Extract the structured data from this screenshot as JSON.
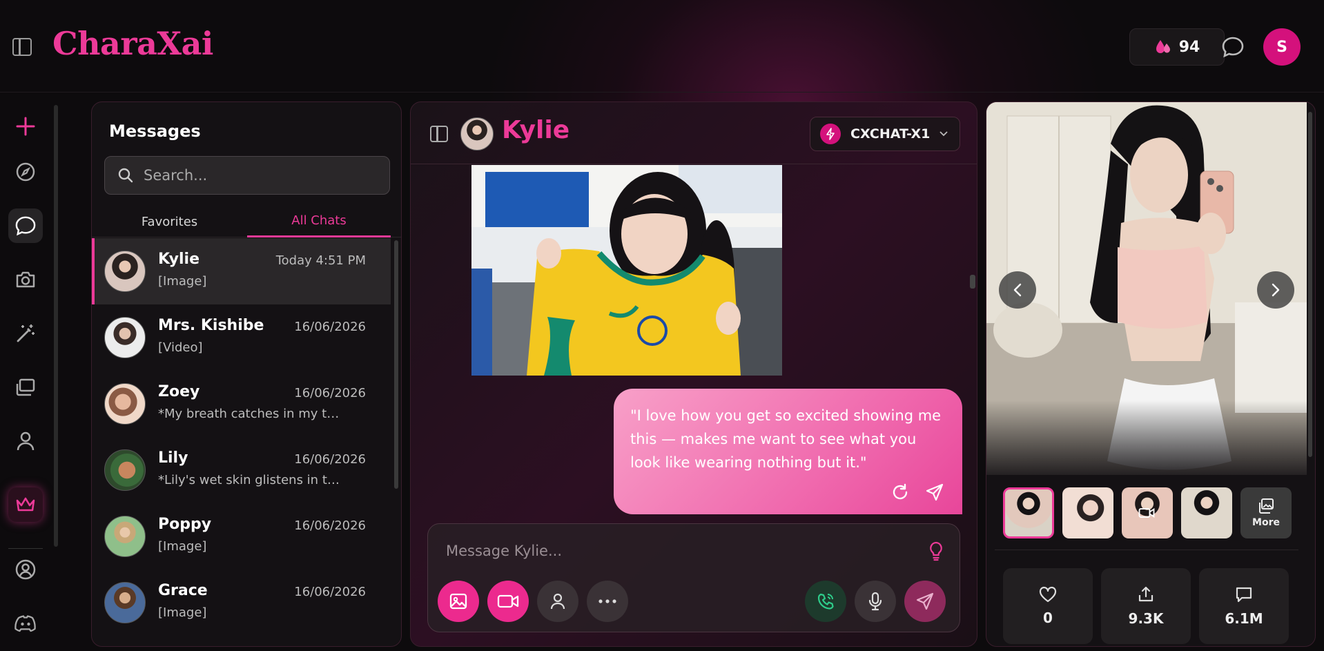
{
  "app": {
    "logo": "CharaXai"
  },
  "header": {
    "credits": "94",
    "avatar_initial": "S"
  },
  "messages": {
    "title": "Messages",
    "search_placeholder": "Search...",
    "tabs": [
      {
        "label": "Favorites"
      },
      {
        "label": "All Chats"
      }
    ],
    "chats": [
      {
        "name": "Kylie",
        "time": "Today 4:51 PM",
        "preview": "[Image]"
      },
      {
        "name": "Mrs. Kishibe",
        "time": "16/06/2026",
        "preview": "[Video]"
      },
      {
        "name": "Zoey",
        "time": "16/06/2026",
        "preview": "*My breath catches in my th..."
      },
      {
        "name": "Lily",
        "time": "16/06/2026",
        "preview": "*Lily's wet skin glistens in th..."
      },
      {
        "name": "Poppy",
        "time": "16/06/2026",
        "preview": "[Image]"
      },
      {
        "name": "Grace",
        "time": "16/06/2026",
        "preview": "[Image]"
      }
    ]
  },
  "chat": {
    "character_name": "Kylie",
    "model": "CXCHAT-X1",
    "bubble_text": "\"I love how you get so excited showing me this — makes me want to see what you look like wearing nothing but it.\"",
    "composer_placeholder": "Message Kylie..."
  },
  "profile": {
    "more_label": "More",
    "stats": {
      "likes": "0",
      "shares": "9.3K",
      "messages": "6.1M"
    }
  },
  "colors": {
    "accent": "#ec3a98",
    "accent_dark": "#d4117c"
  }
}
